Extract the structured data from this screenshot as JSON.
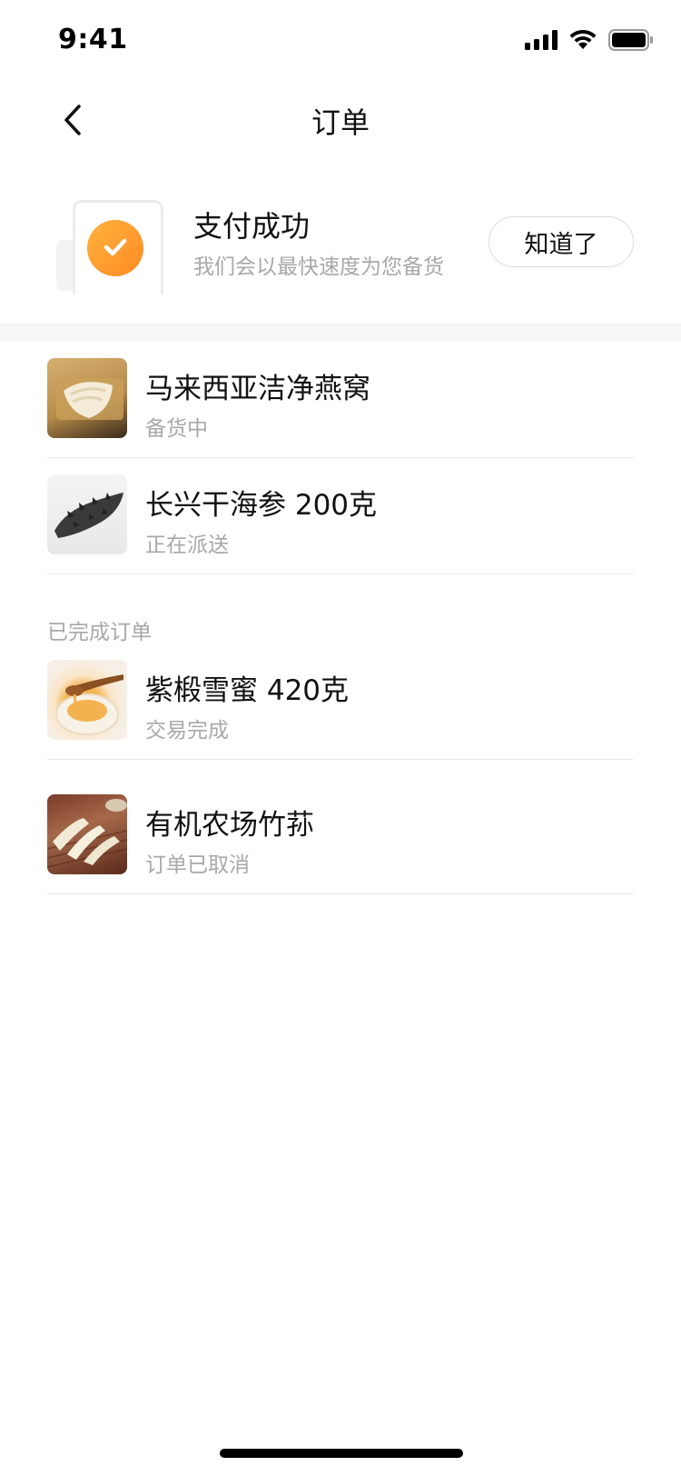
{
  "status_bar": {
    "time": "9:41"
  },
  "nav": {
    "title": "订单"
  },
  "payment": {
    "title": "支付成功",
    "subtitle": "我们会以最快速度为您备货",
    "ok_label": "知道了"
  },
  "active_orders": [
    {
      "name": "马来西亚洁净燕窝",
      "status": "备货中",
      "thumb": "bird-nest"
    },
    {
      "name": "长兴干海参 200克",
      "status": "正在派送",
      "thumb": "sea-cucumber"
    }
  ],
  "completed_section": {
    "label": "已完成订单",
    "orders": [
      {
        "name": "紫椴雪蜜 420克",
        "status": "交易完成",
        "thumb": "honey"
      },
      {
        "name": "有机农场竹荪",
        "status": "订单已取消",
        "thumb": "bamboo-fungus"
      }
    ]
  },
  "colors": {
    "accent": "#ff9a2e",
    "muted_text": "#a8a8a8",
    "divider": "#e8e8e8"
  }
}
